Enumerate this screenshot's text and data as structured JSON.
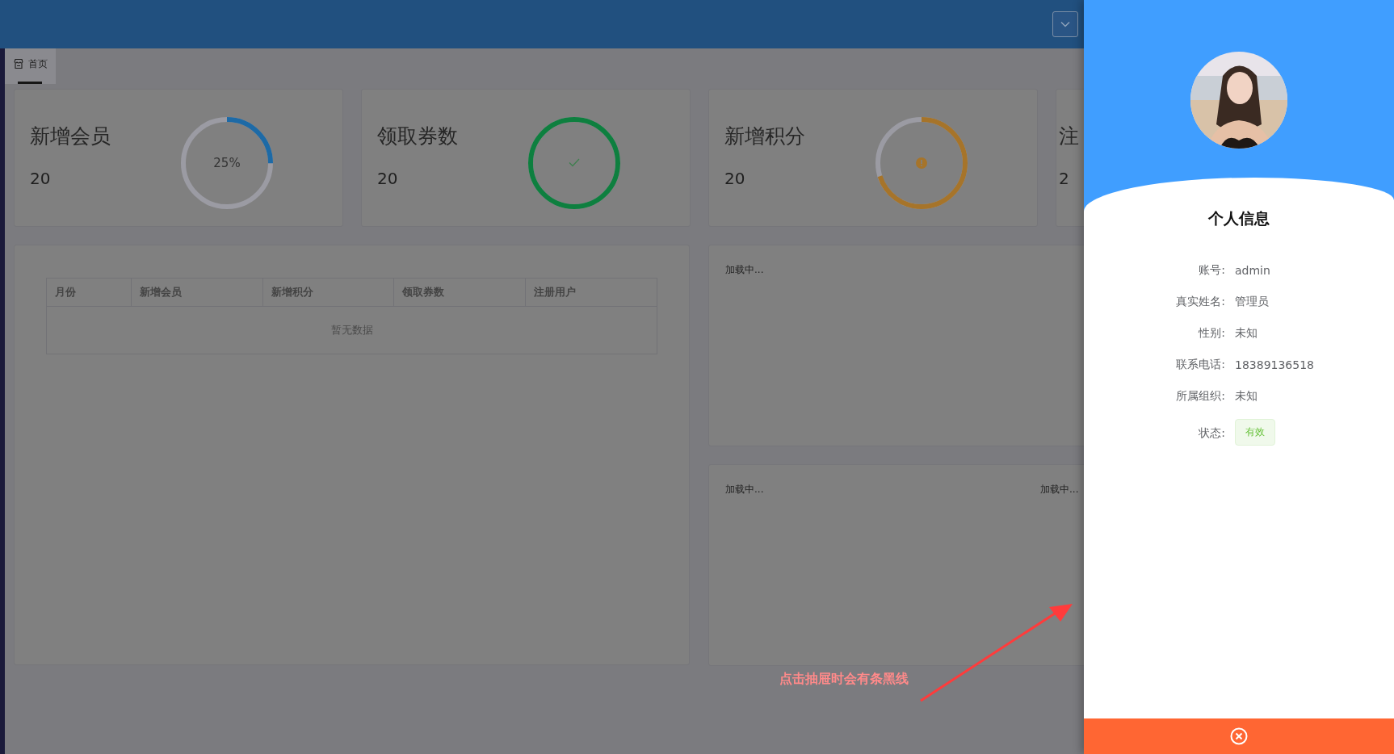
{
  "header": {
    "menu_button": {
      "expanded": false
    }
  },
  "tabs": [
    {
      "label": "首页",
      "selected": true
    }
  ],
  "stat_cards": [
    {
      "title": "新增会员",
      "value": "20",
      "progress": {
        "kind": "percent",
        "level": 0.25,
        "text": "25%"
      }
    },
    {
      "title": "领取券数",
      "value": "20",
      "progress": {
        "kind": "success",
        "level": 1
      }
    },
    {
      "title": "新增积分",
      "value": "20",
      "progress": {
        "kind": "exception",
        "level": 0.7
      }
    },
    {
      "title": "注",
      "value": "2"
    }
  ],
  "table": {
    "columns": [
      "月份",
      "新增会员",
      "新增积分",
      "领取券数",
      "注册用户"
    ],
    "empty_text": "暂无数据"
  },
  "chart_panels": [
    {
      "loading_texts": [
        "加载中..."
      ]
    },
    {
      "loading_texts": [
        "加载中...",
        "加载中..."
      ]
    }
  ],
  "annotation": {
    "text": "点击抽屉时会有条黑线"
  },
  "drawer": {
    "title": "个人信息",
    "fields": [
      {
        "label": "账号:",
        "value": "admin",
        "kind": "text"
      },
      {
        "label": "真实姓名:",
        "value": "管理员",
        "kind": "text"
      },
      {
        "label": "性别:",
        "value": "未知",
        "kind": "text"
      },
      {
        "label": "联系电话:",
        "value": "18389136518",
        "kind": "text"
      },
      {
        "label": "所属组织:",
        "value": "未知",
        "kind": "text"
      },
      {
        "label": "状态:",
        "value": "有效",
        "kind": "tag"
      }
    ]
  }
}
